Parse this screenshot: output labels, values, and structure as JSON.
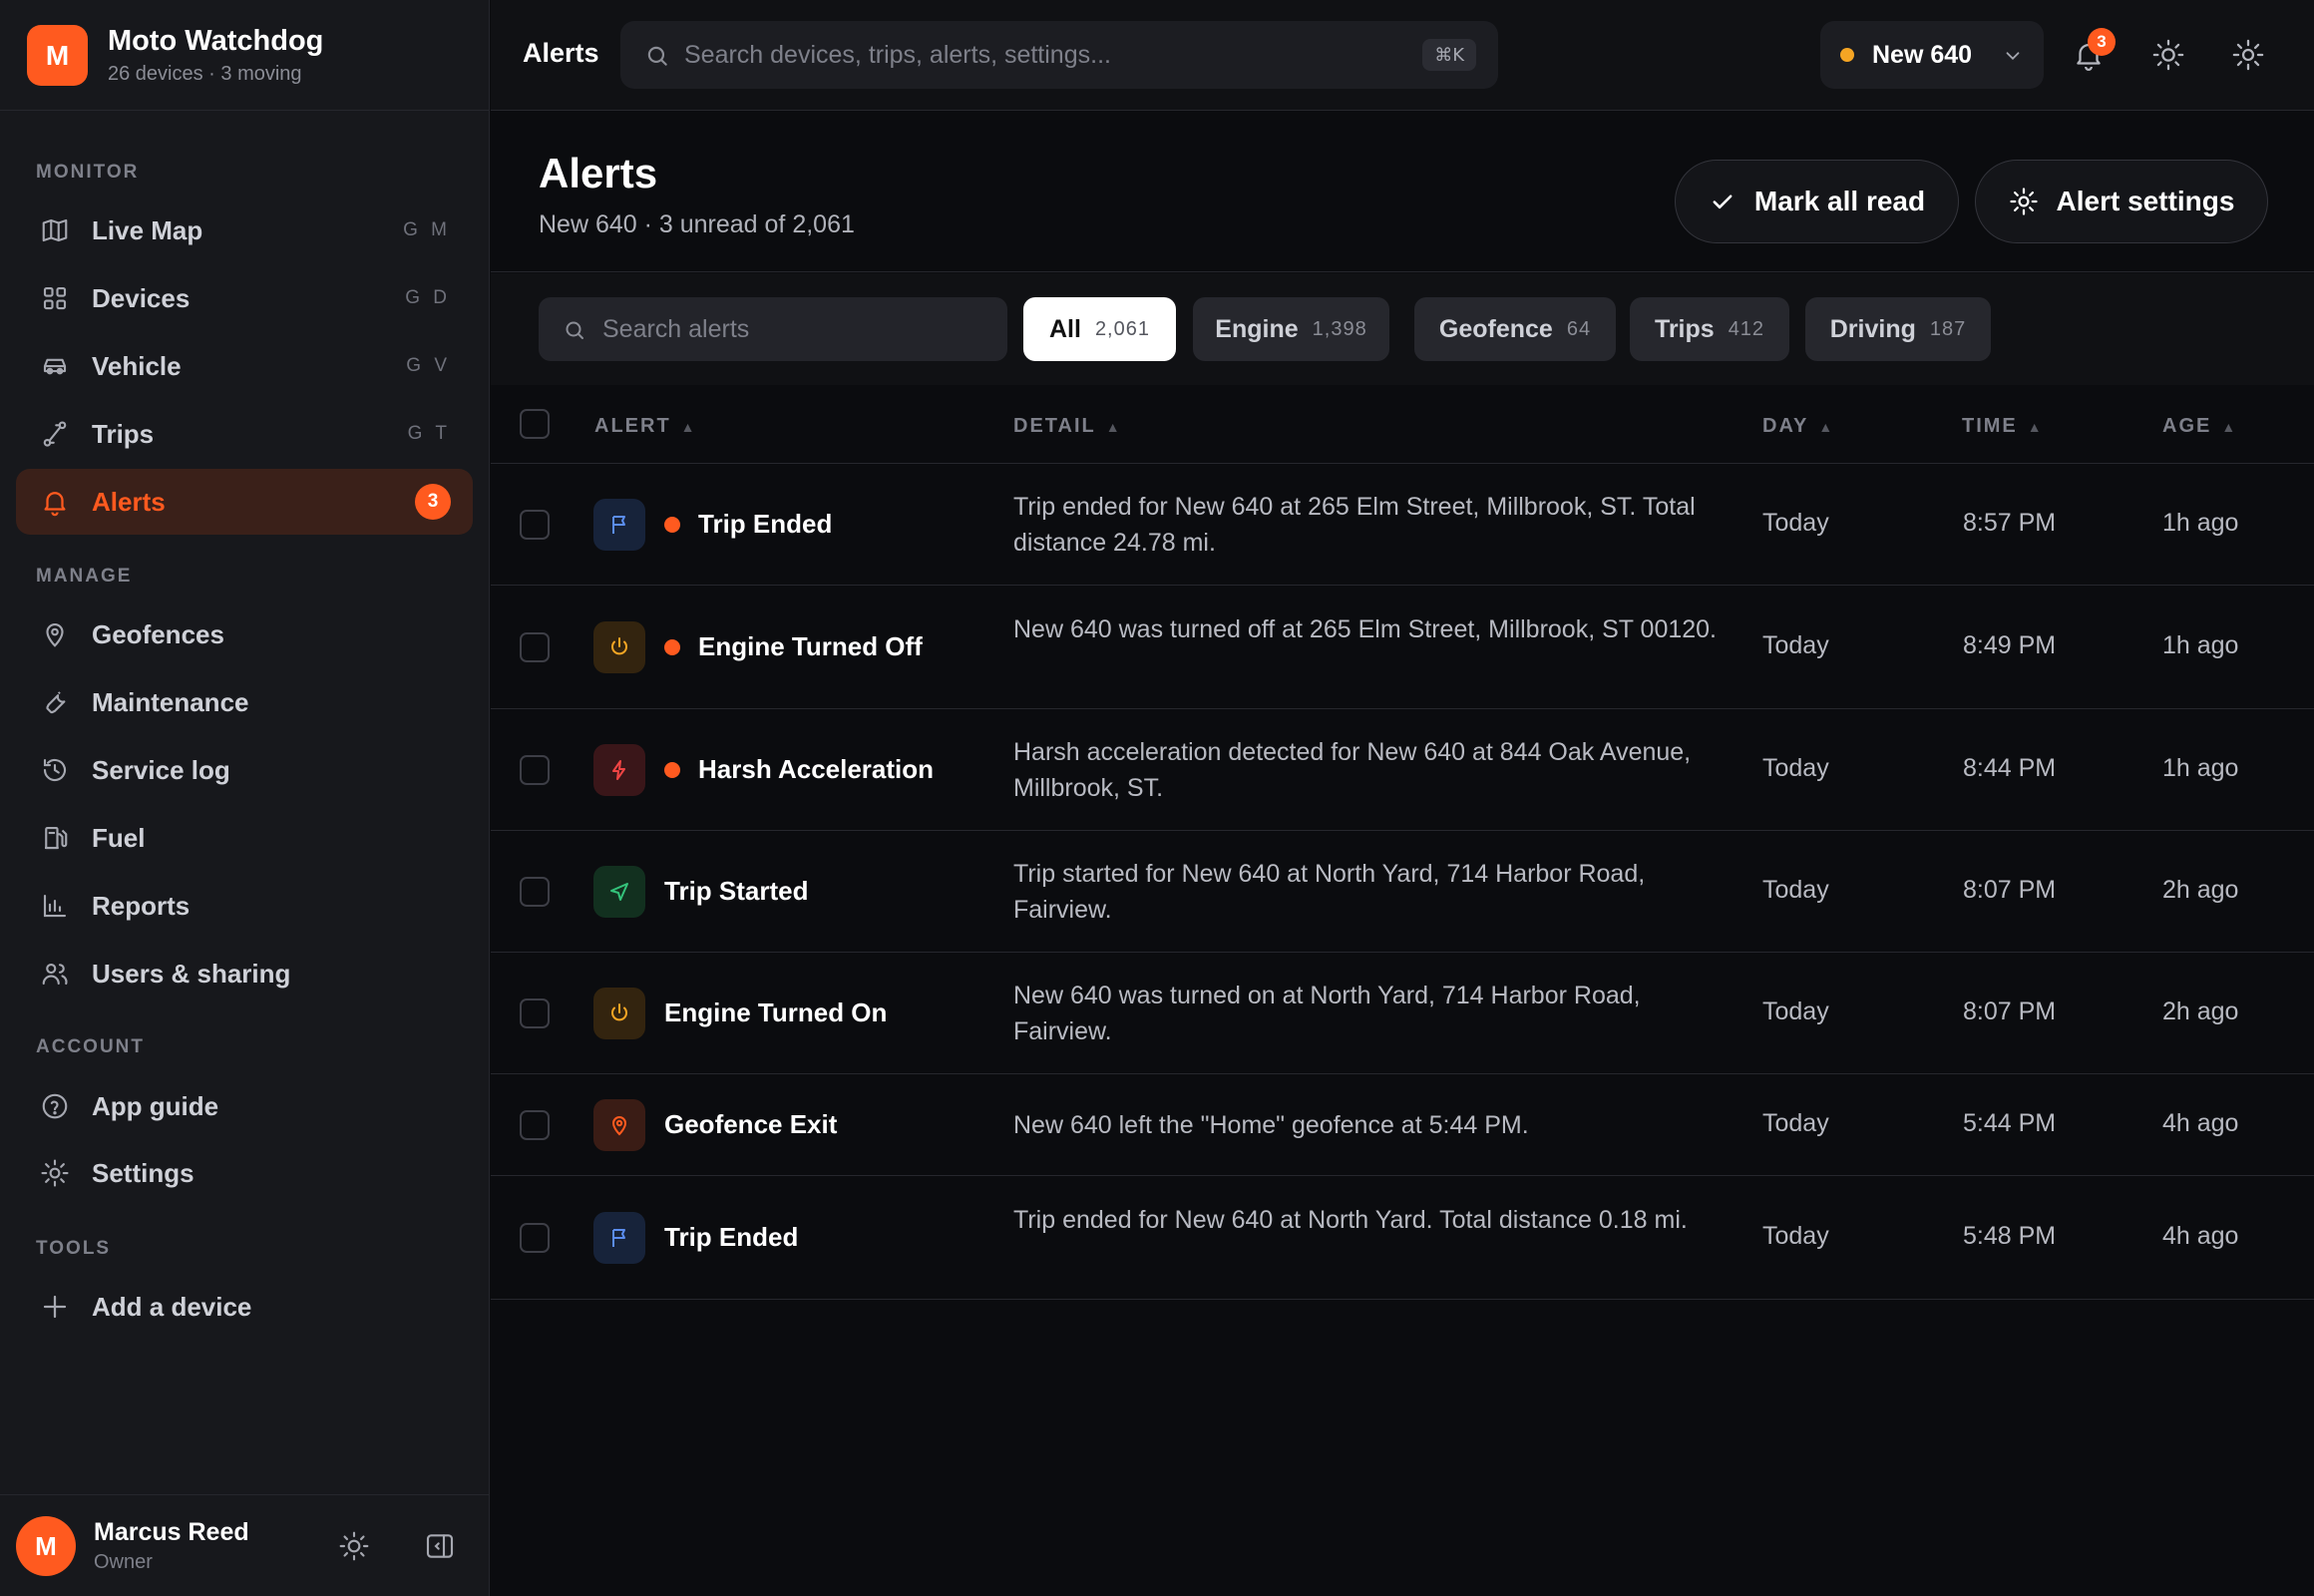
{
  "brand": {
    "logo_letter": "M",
    "name": "Moto Watchdog",
    "subtitle": "26 devices · 3 moving"
  },
  "sidebar": {
    "sections": {
      "monitor": "MONITOR",
      "manage": "MANAGE",
      "account": "ACCOUNT",
      "tools": "TOOLS"
    },
    "monitor_items": [
      {
        "label": "Live Map",
        "shortcut": "G M",
        "icon": "map-icon"
      },
      {
        "label": "Devices",
        "shortcut": "G D",
        "icon": "grid-icon"
      },
      {
        "label": "Vehicle",
        "shortcut": "G V",
        "icon": "car-icon"
      },
      {
        "label": "Trips",
        "shortcut": "G T",
        "icon": "route-icon"
      },
      {
        "label": "Alerts",
        "badge": "3",
        "icon": "bell-icon",
        "active": true
      }
    ],
    "manage_items": [
      {
        "label": "Geofences",
        "icon": "pin-icon"
      },
      {
        "label": "Maintenance",
        "icon": "wrench-icon"
      },
      {
        "label": "Service log",
        "icon": "history-icon"
      },
      {
        "label": "Fuel",
        "icon": "fuel-icon"
      },
      {
        "label": "Reports",
        "icon": "bar-chart-icon"
      },
      {
        "label": "Users & sharing",
        "icon": "users-icon"
      }
    ],
    "account_items": [
      {
        "label": "App guide",
        "icon": "help-icon"
      },
      {
        "label": "Settings",
        "icon": "gear-icon"
      }
    ],
    "tools_items": [
      {
        "label": "Add a device",
        "icon": "plus-icon"
      }
    ],
    "user": {
      "initial": "M",
      "name": "Marcus Reed",
      "role": "Owner"
    }
  },
  "topbar": {
    "title": "Alerts",
    "search_placeholder": "Search devices, trips, alerts, settings...",
    "search_shortcut": "⌘K",
    "device": "New 640",
    "notification_count": "3"
  },
  "page": {
    "title": "Alerts",
    "subtitle": "New 640 · 3 unread of 2,061",
    "mark_all_read": "Mark all read",
    "alert_settings": "Alert settings"
  },
  "filters": {
    "search_placeholder": "Search alerts",
    "chips": [
      {
        "label": "All",
        "count": "2,061",
        "active": true
      },
      {
        "label": "Engine",
        "count": "1,398"
      },
      {
        "label": "Geofence",
        "count": "64"
      },
      {
        "label": "Trips",
        "count": "412"
      },
      {
        "label": "Driving",
        "count": "187"
      }
    ]
  },
  "table": {
    "headers": {
      "alert": "ALERT",
      "detail": "DETAIL",
      "day": "DAY",
      "time": "TIME",
      "age": "AGE"
    },
    "rows": [
      {
        "alert": "Trip Ended",
        "icon": "flag-icon",
        "unread": true,
        "detail": "Trip ended for New 640 at 265 Elm Street, Millbrook, ST. Total distance 24.78 mi.",
        "day": "Today",
        "time": "8:57 PM",
        "age": "1h ago"
      },
      {
        "alert": "Engine Turned Off",
        "icon": "power-icon",
        "unread": true,
        "detail": "New 640 was turned off at 265 Elm Street, Millbrook, ST 00120.",
        "day": "Today",
        "time": "8:49 PM",
        "age": "1h ago"
      },
      {
        "alert": "Harsh Acceleration",
        "icon": "bolt-icon",
        "unread": true,
        "detail": "Harsh acceleration detected for New 640 at 844 Oak Avenue, Millbrook, ST.",
        "day": "Today",
        "time": "8:44 PM",
        "age": "1h ago"
      },
      {
        "alert": "Trip Started",
        "icon": "navigation-icon",
        "unread": false,
        "detail": "Trip started for New 640 at North Yard, 714 Harbor Road, Fairview.",
        "day": "Today",
        "time": "8:07 PM",
        "age": "2h ago"
      },
      {
        "alert": "Engine Turned On",
        "icon": "power-icon",
        "unread": false,
        "detail": "New 640 was turned on at North Yard, 714 Harbor Road, Fairview.",
        "day": "Today",
        "time": "8:07 PM",
        "age": "2h ago"
      },
      {
        "alert": "Geofence Exit",
        "icon": "pin-icon",
        "unread": false,
        "detail": "New 640 left the \"Home\" geofence at 5:44 PM.",
        "day": "Today",
        "time": "5:44 PM",
        "age": "4h ago"
      },
      {
        "alert": "Trip Ended",
        "icon": "flag-icon",
        "unread": false,
        "detail": "Trip ended for New 640 at North Yard. Total distance 0.18 mi.",
        "day": "Today",
        "time": "5:48 PM",
        "age": "4h ago"
      }
    ]
  },
  "colors": {
    "accent": "#ff5a1f",
    "amber": "#f5a524",
    "blue": "#5b8def",
    "green": "#34c27a",
    "red": "#ef4444",
    "background": "#0b0c0f",
    "sidebar": "#17181c"
  }
}
